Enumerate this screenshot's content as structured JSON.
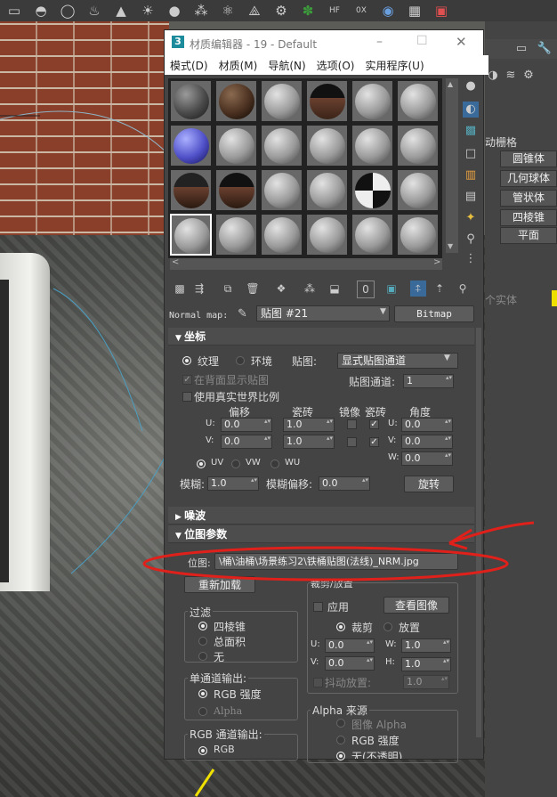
{
  "toolbar": {
    "icons": [
      "box-icon",
      "sphere-icon",
      "torus-icon",
      "teapot-icon",
      "cone-icon",
      "sun-icon",
      "circle-icon",
      "grid-icon",
      "molecule-icon",
      "wire-icon",
      "gear-icon",
      "plant-icon",
      "hf-icon",
      "spiral-icon",
      "globe-icon",
      "slate-icon",
      "render-icon"
    ],
    "hf_label": "HF",
    "ox_label": "0X"
  },
  "command_panel": {
    "label_grid": "动栅格",
    "buttons": [
      "圆锥体",
      "几何球体",
      "管状体",
      "四棱锥",
      "平面"
    ],
    "label_entity": "个实体"
  },
  "material_editor": {
    "title_icon": "3",
    "title": "材质编辑器 - 19 - Default",
    "menu": [
      "模式(D)",
      "材质(M)",
      "导航(N)",
      "选项(O)",
      "实用程序(U)"
    ],
    "map_label": "Normal map:",
    "map_name": "贴图 #21",
    "map_type": "Bitmap",
    "coords": {
      "header": "坐标",
      "texture": "纹理",
      "environ": "环境",
      "mapping_label": "贴图:",
      "mapping_value": "显式贴图通道",
      "show_back": "在背面显示贴图",
      "channel_label": "贴图通道:",
      "channel_value": "1",
      "real_world": "使用真实世界比例",
      "col_offset": "偏移",
      "col_tiling": "瓷砖",
      "col_mirror": "镜像",
      "col_tile": "瓷砖",
      "col_angle": "角度",
      "u_label": "U:",
      "v_label": "V:",
      "w_label": "W:",
      "u_offset": "0.0",
      "v_offset": "0.0",
      "u_tiling": "1.0",
      "v_tiling": "1.0",
      "u_angle": "0.0",
      "v_angle": "0.0",
      "w_angle": "0.0",
      "uv": "UV",
      "vw": "VW",
      "wu": "WU",
      "blur_label": "模糊:",
      "blur_value": "1.0",
      "blur_offset_label": "模糊偏移:",
      "blur_offset_value": "0.0",
      "rotate": "旋转"
    },
    "noise_header": "噪波",
    "bitmap": {
      "header": "位图参数",
      "path_label": "位图:",
      "path": "\\桶\\油桶\\场景练习2\\铁桶贴图(法线)_NRM.jpg",
      "reload": "重新加载",
      "filter_label": "过滤",
      "filter_opts": [
        "四棱锥",
        "总面积",
        "无"
      ],
      "mono_label": "单通道输出:",
      "mono_opts": [
        "RGB 强度",
        "Alpha"
      ],
      "rgb_label": "RGB 通道输出:",
      "rgb_opts": [
        "RGB"
      ],
      "crop_label": "裁剪/放置",
      "apply": "应用",
      "view": "查看图像",
      "crop": "裁剪",
      "place": "放置",
      "u_label": "U:",
      "v_label": "V:",
      "w_label": "W:",
      "h_label": "H:",
      "u": "0.0",
      "v": "0.0",
      "w": "1.0",
      "h": "1.0",
      "jitter": "抖动放置:",
      "jitter_value": "1.0",
      "alpha_src": "Alpha 来源",
      "alpha_opts": [
        "图像 Alpha",
        "RGB 强度",
        "无(不透明)"
      ]
    }
  },
  "colors": {
    "panel": "#444444",
    "accent_yellow": "#f0e000",
    "annotation_red": "#e0201a"
  }
}
